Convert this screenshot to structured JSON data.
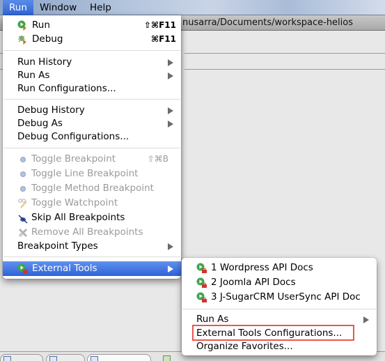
{
  "menubar": {
    "items": [
      {
        "label": "Run",
        "active": true
      },
      {
        "label": "Window",
        "active": false
      },
      {
        "label": "Help",
        "active": false
      }
    ]
  },
  "window": {
    "title_fragment": "PHP - Eclipse - /Users/musarra/Documents/workspace-helios",
    "visible_title": "nusarra/Documents/workspace-helios"
  },
  "run_menu": {
    "items": [
      {
        "label": "Run",
        "icon": "run-icon",
        "shortcut": "⇧⌘F11",
        "enabled": true
      },
      {
        "label": "Debug",
        "icon": "debug-icon",
        "shortcut": "⌘F11",
        "enabled": true
      },
      {
        "label": "Run History",
        "submenu": true,
        "enabled": true
      },
      {
        "label": "Run As",
        "submenu": true,
        "enabled": true
      },
      {
        "label": "Run Configurations...",
        "enabled": true
      },
      {
        "label": "Debug History",
        "submenu": true,
        "enabled": true
      },
      {
        "label": "Debug As",
        "submenu": true,
        "enabled": true
      },
      {
        "label": "Debug Configurations...",
        "enabled": true
      },
      {
        "label": "Toggle Breakpoint",
        "icon": "breakpoint-dot-icon",
        "shortcut": "⇧⌘B",
        "enabled": false
      },
      {
        "label": "Toggle Line Breakpoint",
        "icon": "breakpoint-dot-icon",
        "enabled": false
      },
      {
        "label": "Toggle Method Breakpoint",
        "icon": "breakpoint-dot-icon",
        "enabled": false
      },
      {
        "label": "Toggle Watchpoint",
        "icon": "watchpoint-icon",
        "enabled": false
      },
      {
        "label": "Skip All Breakpoints",
        "icon": "skip-breakpoints-icon",
        "enabled": true
      },
      {
        "label": "Remove All Breakpoints",
        "icon": "remove-breakpoints-icon",
        "enabled": false
      },
      {
        "label": "Breakpoint Types",
        "submenu": true,
        "enabled": true
      },
      {
        "label": "External Tools",
        "icon": "external-tools-icon",
        "submenu": true,
        "enabled": true,
        "highlighted": true
      }
    ]
  },
  "external_tools_submenu": {
    "items": [
      {
        "label": "1 Wordpress API Docs",
        "icon": "external-tools-icon"
      },
      {
        "label": "2 Joomla API Docs",
        "icon": "external-tools-icon"
      },
      {
        "label": "3 J-SugarCRM UserSync API Doc",
        "icon": "external-tools-icon"
      },
      {
        "label": "Run As",
        "submenu": true
      },
      {
        "label": "External Tools Configurations...",
        "annotated": true
      },
      {
        "label": "Organize Favorites..."
      }
    ]
  },
  "annotation": {
    "color": "#e8574f"
  },
  "colors": {
    "highlight": "#2e63d8",
    "disabled_text": "#9a9a9a"
  }
}
